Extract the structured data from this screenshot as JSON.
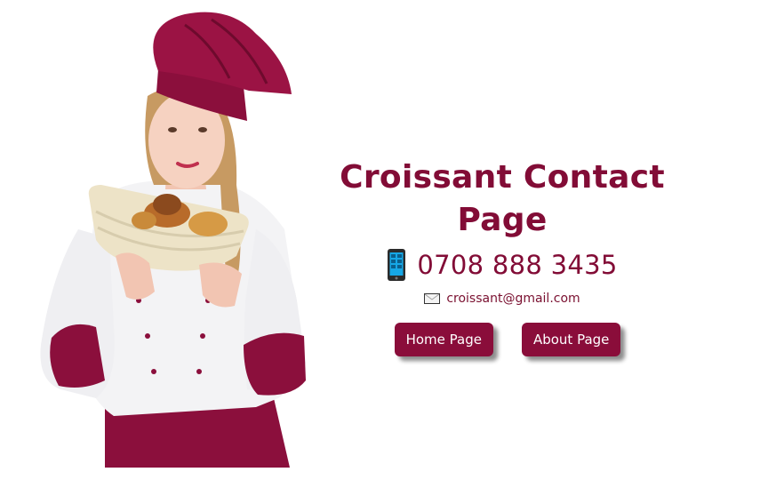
{
  "header": {
    "title": "Croissant Contact Page"
  },
  "contact": {
    "phone_icon": "mobile-phone-icon",
    "phone": "0708 888 3435",
    "email_icon": "envelope-icon",
    "email": "croissant@gmail.com"
  },
  "nav": {
    "home_label": "Home Page",
    "about_label": "About Page"
  },
  "colors": {
    "brand": "#820c36",
    "button": "#8a0d3a",
    "background": "#ffffff"
  }
}
